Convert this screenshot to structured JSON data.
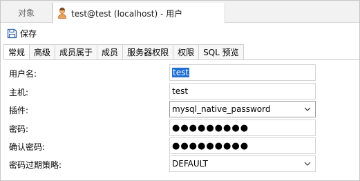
{
  "doc_tabs": {
    "objects": "对象",
    "user_tab": "test@test (localhost) - 用户"
  },
  "toolbar": {
    "save_label": "保存"
  },
  "tabs": [
    {
      "label": "常规"
    },
    {
      "label": "高级"
    },
    {
      "label": "成员属于"
    },
    {
      "label": "成员"
    },
    {
      "label": "服务器权限"
    },
    {
      "label": "权限"
    },
    {
      "label": "SQL 预览"
    }
  ],
  "form": {
    "username": {
      "label": "用户名:",
      "value": "test"
    },
    "host": {
      "label": "主机:",
      "value": "test"
    },
    "plugin": {
      "label": "插件:",
      "value": "mysql_native_password"
    },
    "password": {
      "label": "密码:",
      "value": "●●●●●●●●●"
    },
    "confirm_password": {
      "label": "确认密码:",
      "value": "●●●●●●●●●"
    },
    "password_expire": {
      "label": "密码过期策略:",
      "value": "DEFAULT"
    }
  }
}
